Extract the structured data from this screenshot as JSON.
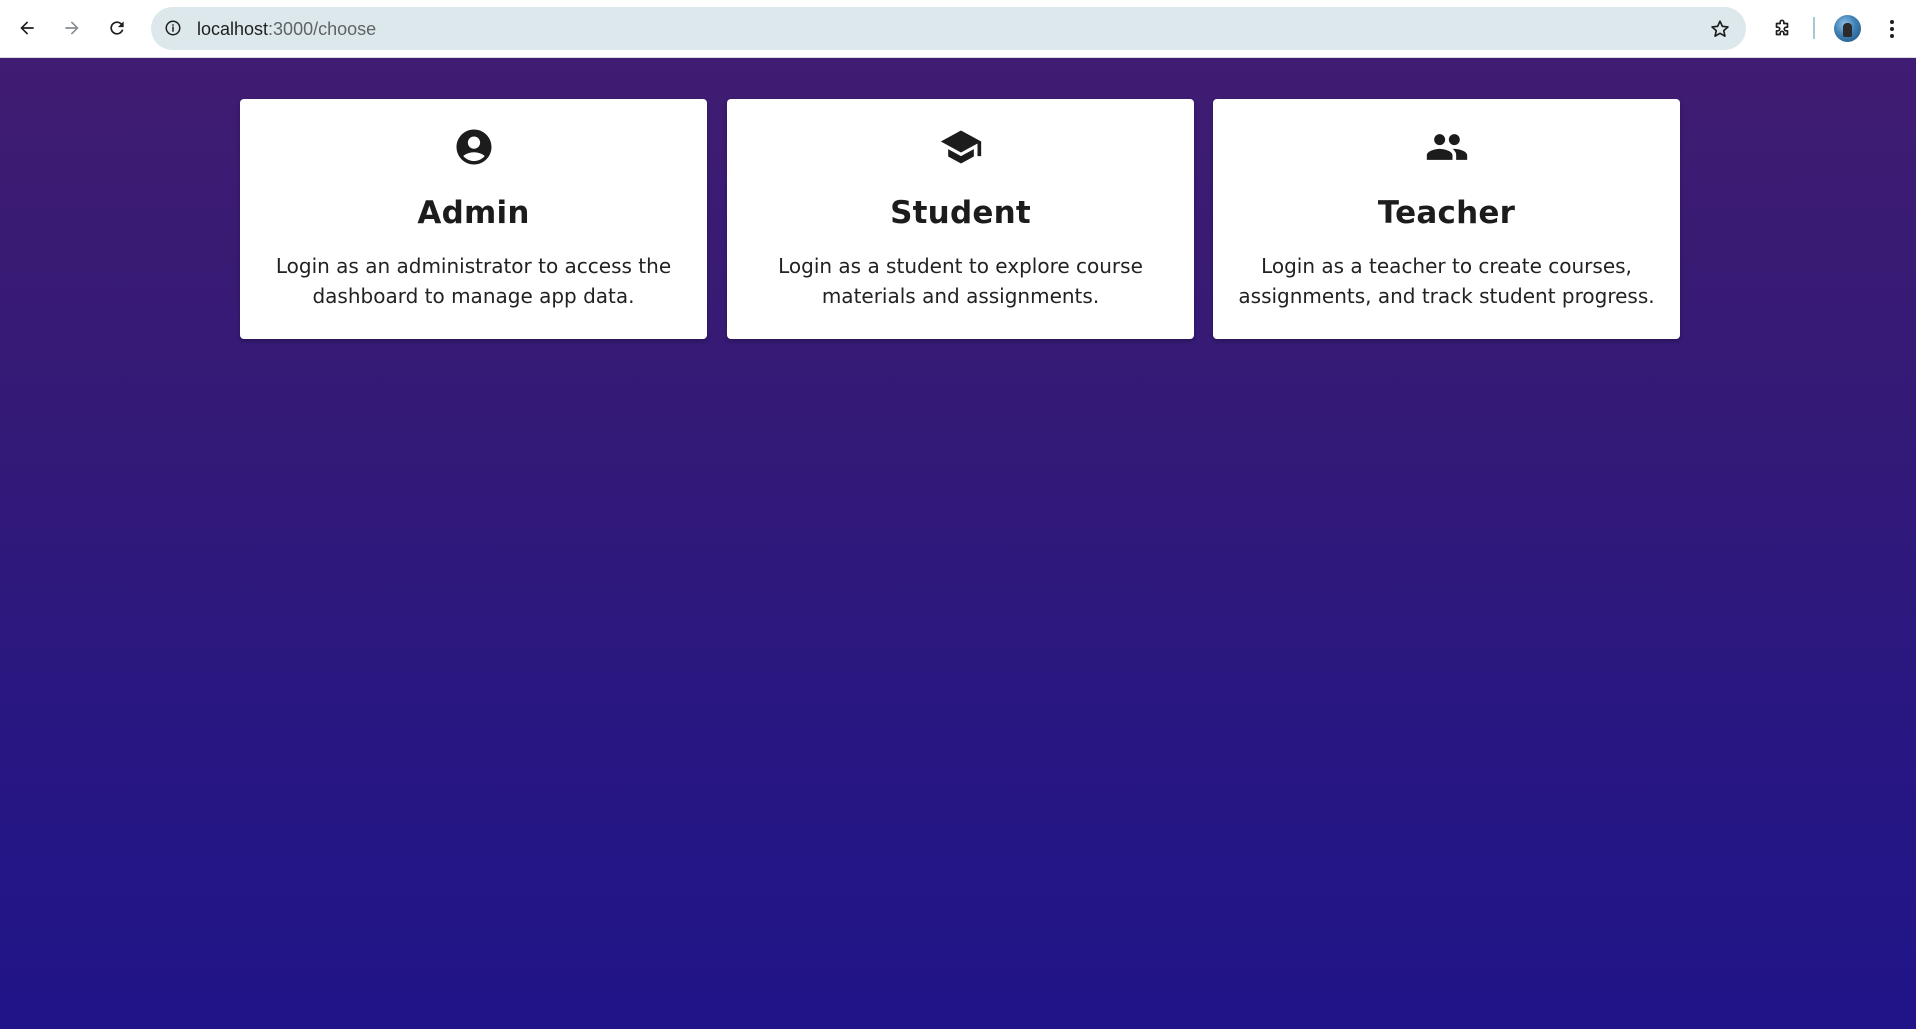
{
  "browser": {
    "url_host": "localhost",
    "url_path": ":3000/choose",
    "back_icon": "arrow-left-icon",
    "forward_icon": "arrow-right-icon",
    "reload_icon": "reload-icon",
    "site_info_icon": "info-circle-icon",
    "bookmark_icon": "star-icon",
    "extensions_icon": "puzzle-icon",
    "menu_icon": "kebab-menu-icon"
  },
  "page": {
    "background_top": "#401c72",
    "background_bottom": "#201488",
    "cards": [
      {
        "icon": "account-circle-icon",
        "title": "Admin",
        "description": "Login as an administrator to access the dashboard to manage app data."
      },
      {
        "icon": "graduation-cap-icon",
        "title": "Student",
        "description": "Login as a student to explore course materials and assignments."
      },
      {
        "icon": "people-icon",
        "title": "Teacher",
        "description": "Login as a teacher to create courses, assignments, and track student progress."
      }
    ]
  }
}
